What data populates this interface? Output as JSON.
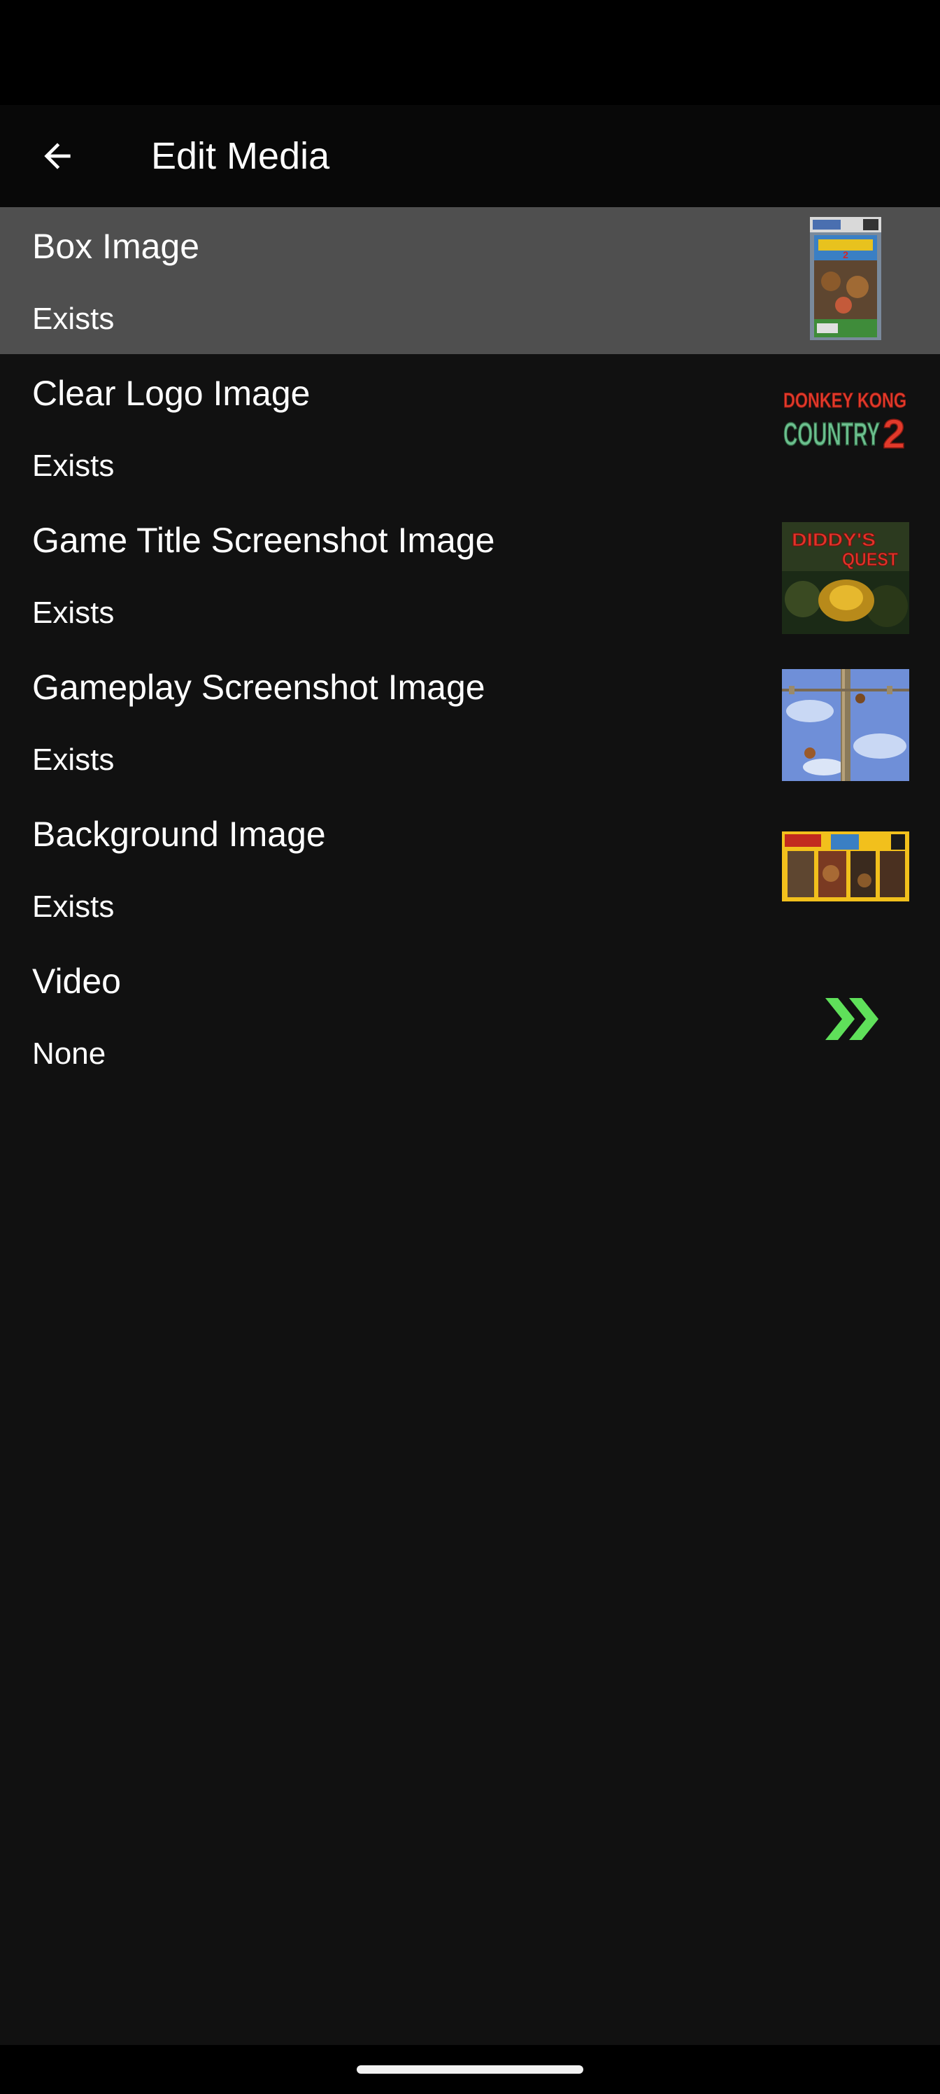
{
  "header": {
    "title": "Edit Media",
    "back_icon": "arrow-left-icon"
  },
  "colors": {
    "background": "#111111",
    "selected_row": "#4f4f4f",
    "accent_green": "#5fe05a"
  },
  "media": {
    "items": [
      {
        "label": "Box Image",
        "status": "Exists",
        "selected": true,
        "thumbnail": "box-art-thumbnail"
      },
      {
        "label": "Clear Logo Image",
        "status": "Exists",
        "selected": false,
        "thumbnail": "clear-logo-thumbnail"
      },
      {
        "label": "Game Title Screenshot Image",
        "status": "Exists",
        "selected": false,
        "thumbnail": "title-screenshot-thumbnail"
      },
      {
        "label": "Gameplay Screenshot Image",
        "status": "Exists",
        "selected": false,
        "thumbnail": "gameplay-screenshot-thumbnail"
      },
      {
        "label": "Background Image",
        "status": "Exists",
        "selected": false,
        "thumbnail": "background-thumbnail"
      },
      {
        "label": "Video",
        "status": "None",
        "selected": false,
        "thumbnail": "double-chevron-right-icon"
      }
    ]
  },
  "logo": {
    "line1": "DONKEY KONG",
    "line2": "COUNTRY",
    "number": "2"
  },
  "title_screen": {
    "line1": "DIDDY'S",
    "line2": "QUEST"
  }
}
